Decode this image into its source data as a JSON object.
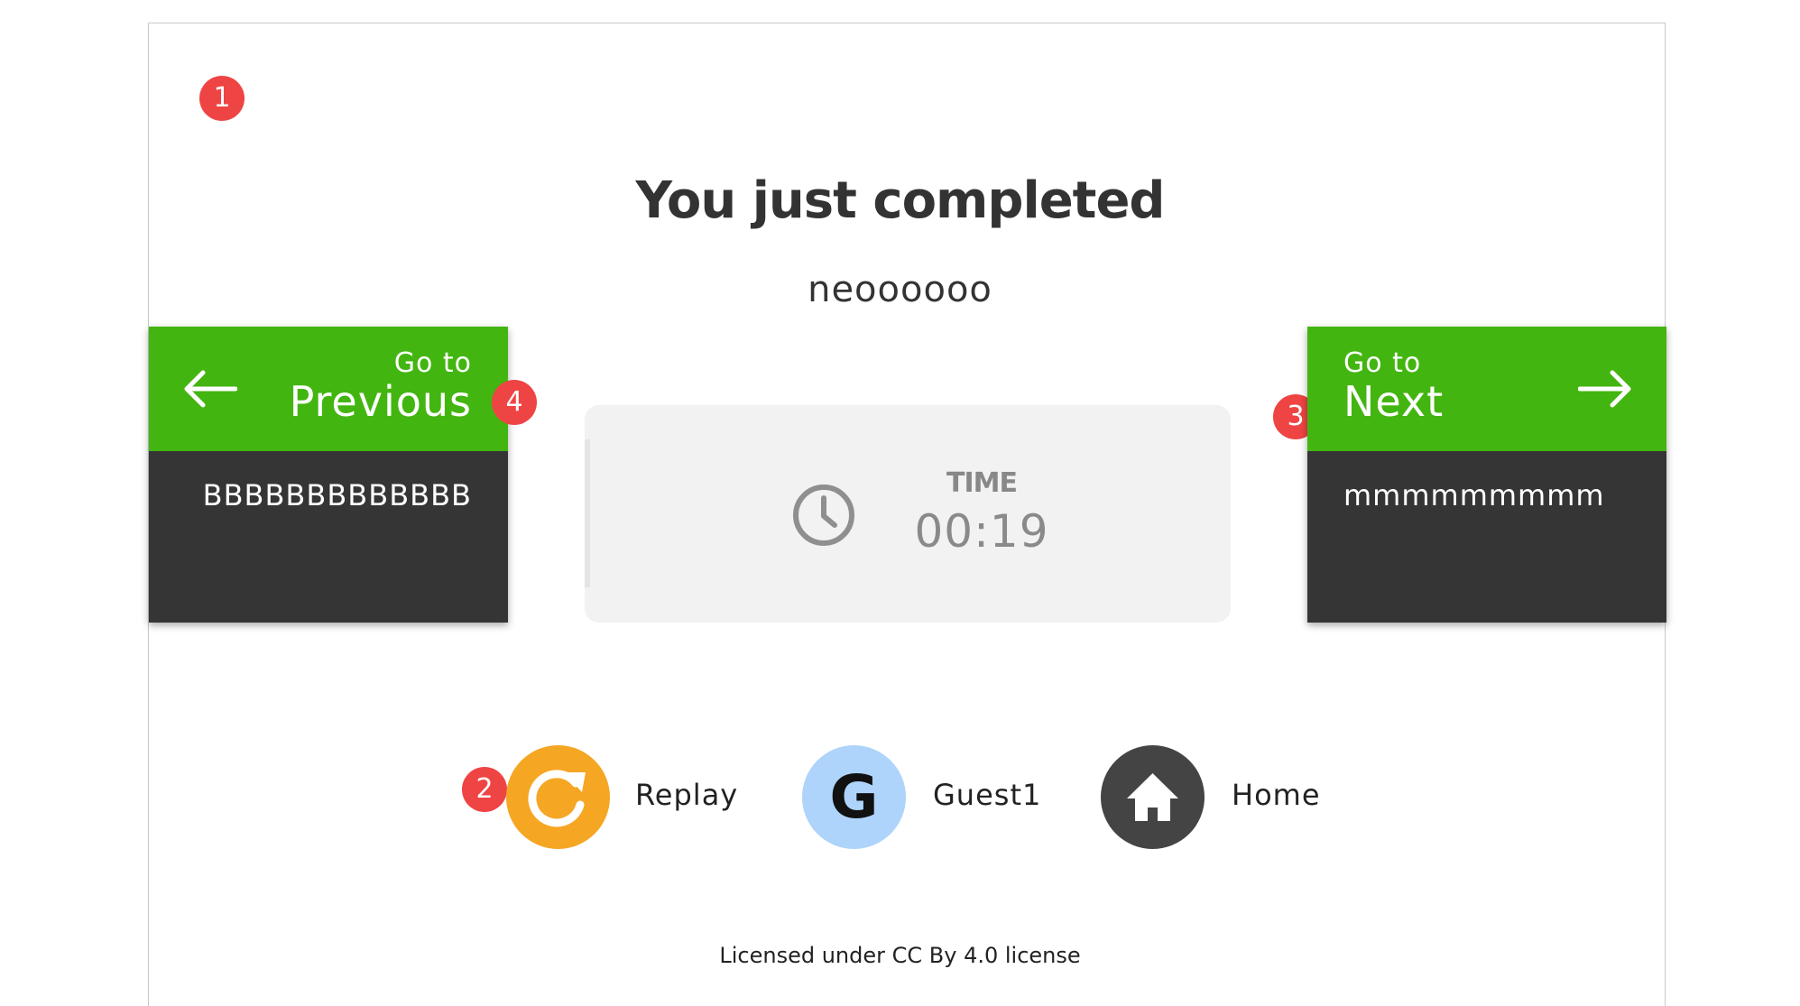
{
  "header": {
    "title": "You just completed",
    "subtitle": "neoooooo"
  },
  "markers": [
    "1",
    "2",
    "3",
    "4"
  ],
  "previous": {
    "goto_label": "Go to",
    "label": "Previous",
    "chapter": "BBBBBBBBBBBBB"
  },
  "next": {
    "goto_label": "Go to",
    "label": "Next",
    "chapter": "mmmmmmmmm"
  },
  "time": {
    "label": "TIME",
    "value": "00:19"
  },
  "actions": {
    "replay": "Replay",
    "guest_initial": "G",
    "guest": "Guest1",
    "home": "Home"
  },
  "footer": {
    "license": "Licensed under CC By 4.0 license"
  },
  "colors": {
    "nav_green": "#43b510",
    "nav_dark": "#353535",
    "replay_orange": "#f5a623",
    "guest_blue": "#aed4fb",
    "home_dark": "#444444",
    "marker_red": "#ef4444"
  }
}
